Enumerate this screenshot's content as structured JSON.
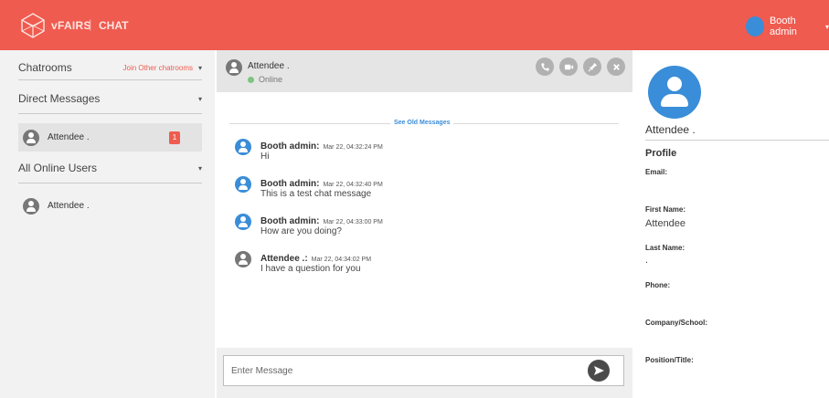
{
  "colors": {
    "accent": "#ef5b4f",
    "blue": "#3a8dd8",
    "online": "#7cc47f"
  },
  "topbar": {
    "brand": "vFAIRS",
    "separator": "|",
    "section": "CHAT",
    "user_name": "Booth admin",
    "caret": "▾",
    "logo_icon": "cube-icon"
  },
  "sidebar": {
    "chatrooms_title": "Chatrooms",
    "join_link": "Join Other chatrooms",
    "direct_title": "Direct Messages",
    "direct_items": [
      {
        "label": "Attendee .",
        "badge": "1"
      }
    ],
    "online_title": "All Online Users",
    "online_items": [
      {
        "label": "Attendee ."
      }
    ]
  },
  "chat": {
    "header": {
      "name": "Attendee .",
      "status": "Online"
    },
    "actions": [
      "phone-icon",
      "video-icon",
      "pin-icon",
      "close-icon"
    ],
    "see_old": "See Old Messages",
    "messages": [
      {
        "sender": "Booth admin:",
        "time": "Mar 22, 04:32:24 PM",
        "text": "Hi"
      },
      {
        "sender": "Booth admin:",
        "time": "Mar 22, 04:32:40 PM",
        "text": "This is a test chat message"
      },
      {
        "sender": "Booth admin:",
        "time": "Mar 22, 04:33:00 PM",
        "text": "How are you doing?"
      },
      {
        "sender": "Attendee .:",
        "time": "Mar 22, 04:34:02 PM",
        "text": "I have a question for you"
      }
    ],
    "input_placeholder": "Enter Message"
  },
  "profile": {
    "name": "Attendee .",
    "title": "Profile",
    "email_label": "Email:",
    "first_name_label": "First Name:",
    "first_name_value": "Attendee",
    "last_name_label": "Last Name:",
    "last_name_value": ".",
    "phone_label": "Phone:",
    "company_label": "Company/School:",
    "position_label": "Position/Title:"
  }
}
